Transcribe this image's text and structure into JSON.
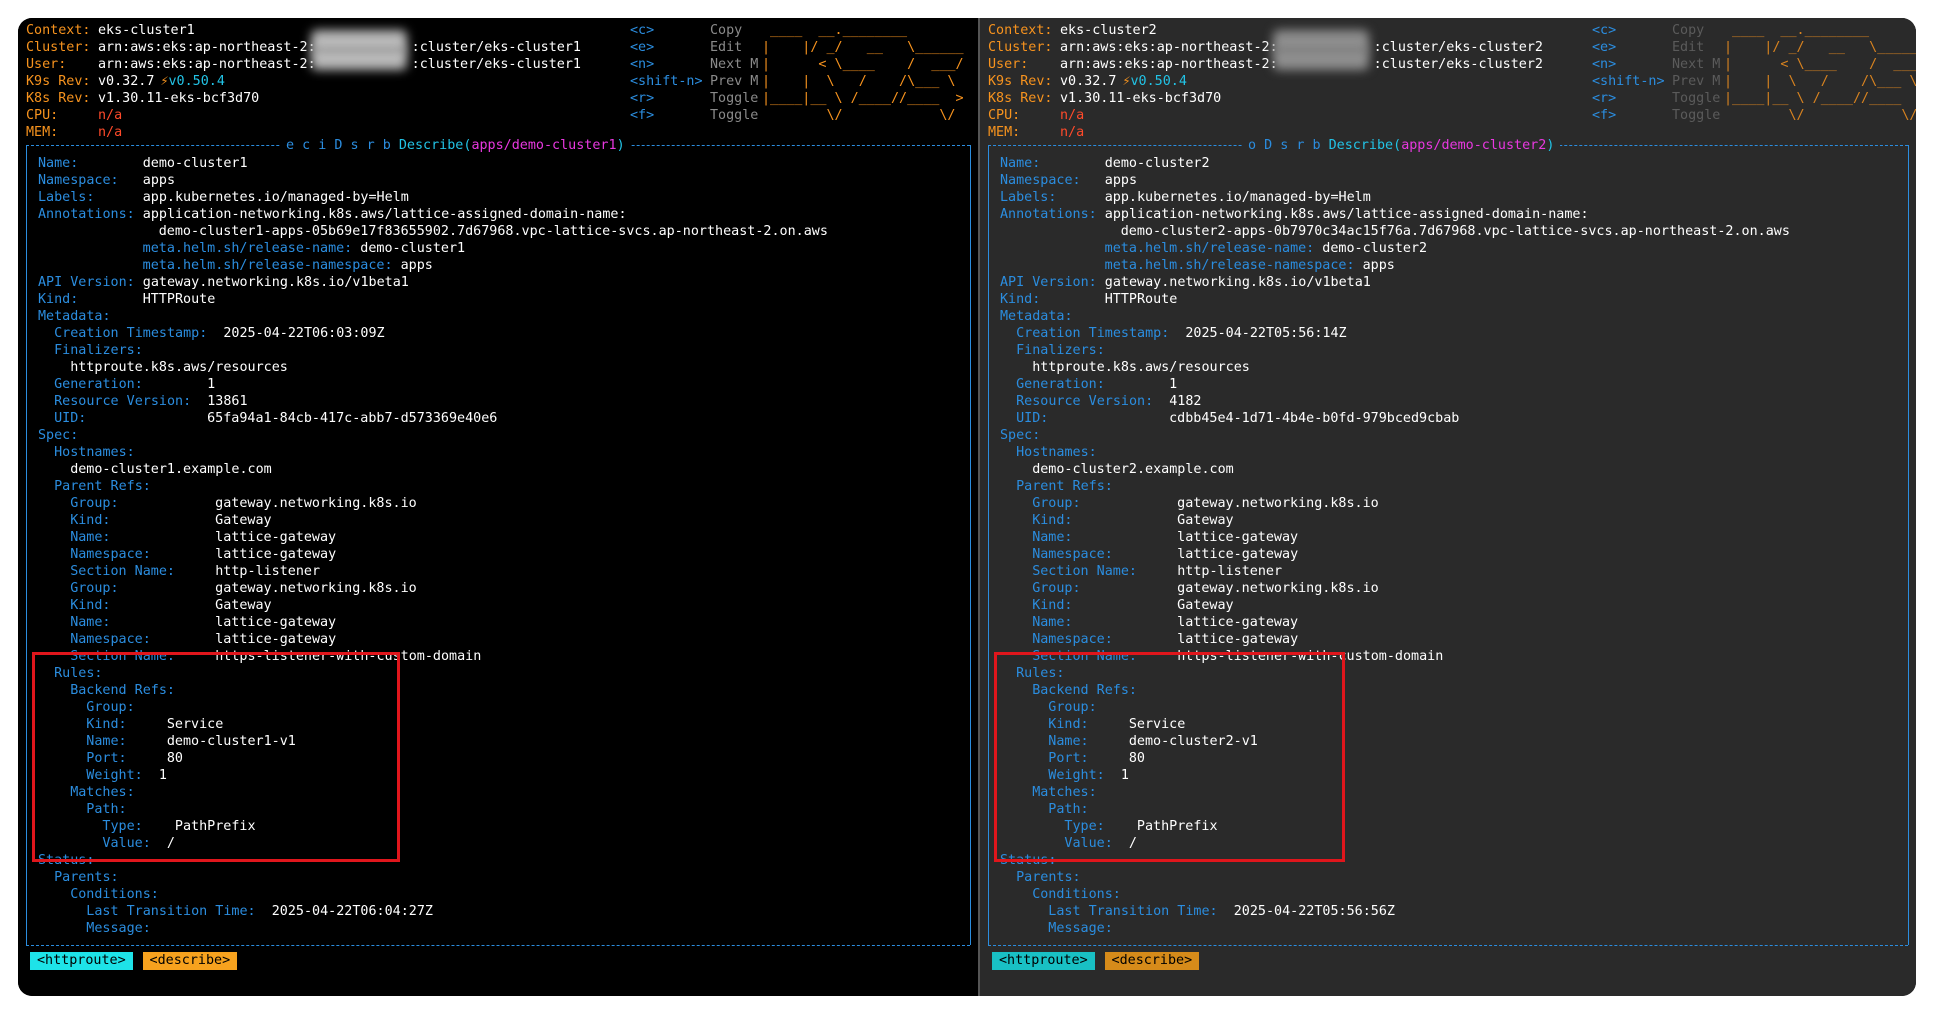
{
  "panes": [
    {
      "id": "cluster1",
      "header": {
        "context_label": "Context:",
        "context": "eks-cluster1",
        "cluster_label": "Cluster:",
        "cluster_prefix": "arn:aws:eks:ap-northeast-2:",
        "cluster_suffix": ":cluster/eks-cluster1",
        "user_label": "User:",
        "user_prefix": "arn:aws:eks:ap-northeast-2:",
        "user_suffix": ":cluster/eks-cluster1",
        "k9s_rev_label": "K9s Rev:",
        "k9s_rev": "v0.32.7",
        "k9s_new": "v0.50.4",
        "bolt": "⚡",
        "k8s_rev_label": "K8s Rev:",
        "k8s_rev": "v1.30.11-eks-bcf3d70",
        "cpu_label": "CPU:",
        "cpu": "n/a",
        "mem_label": "MEM:",
        "mem": "n/a"
      },
      "menu": [
        {
          "key": "<c>",
          "label": "Copy"
        },
        {
          "key": "<e>",
          "label": "Edit"
        },
        {
          "key": "<n>",
          "label": "Next M"
        },
        {
          "key": "<shift-n>",
          "label": "Prev M"
        },
        {
          "key": "<r>",
          "label": "Toggle"
        },
        {
          "key": "<f>",
          "label": "Toggle"
        }
      ],
      "logo_lines": [
        " ____  __.________",
        "|    |/ _/   __   \\______",
        "|      < \\____    /  ___/",
        "|    |  \\   /    /\\___ \\",
        "|____|__ \\ /____//____  >",
        "        \\/            \\/"
      ],
      "title": {
        "hotkeys": "e c i D s r b",
        "word": "Describe",
        "open": "(",
        "resource": "apps/demo-cluster1",
        "close": ")"
      },
      "describe": [
        {
          "i": 0,
          "k": "Name:",
          "v": "demo-cluster1",
          "vx": 13
        },
        {
          "i": 0,
          "k": "Namespace:",
          "v": "apps",
          "vx": 13
        },
        {
          "i": 0,
          "k": "Labels:",
          "v": "app.kubernetes.io/managed-by=Helm",
          "vx": 13
        },
        {
          "i": 0,
          "k": "Annotations:",
          "v": "application-networking.k8s.aws/lattice-assigned-domain-name:",
          "vx": 13
        },
        {
          "i": 15,
          "k": "",
          "v": "demo-cluster1-apps-05b69e17f83655902.7d67968.vpc-lattice-svcs.ap-northeast-2.on.aws",
          "vx": 0
        },
        {
          "i": 13,
          "k": "meta.helm.sh/release-name:",
          "v": "demo-cluster1",
          "vx": 1
        },
        {
          "i": 13,
          "k": "meta.helm.sh/release-namespace:",
          "v": "apps",
          "vx": 1
        },
        {
          "i": 0,
          "k": "API Version:",
          "v": "gateway.networking.k8s.io/v1beta1",
          "vx": 13
        },
        {
          "i": 0,
          "k": "Kind:",
          "v": "HTTPRoute",
          "vx": 13
        },
        {
          "i": 0,
          "k": "Metadata:",
          "v": "",
          "vx": 0
        },
        {
          "i": 2,
          "k": "Creation Timestamp:",
          "v": "2025-04-22T06:03:09Z",
          "vx": 21
        },
        {
          "i": 2,
          "k": "Finalizers:",
          "v": "",
          "vx": 0
        },
        {
          "i": 4,
          "k": "",
          "v": "httproute.k8s.aws/resources",
          "vx": 0
        },
        {
          "i": 2,
          "k": "Generation:",
          "v": "1",
          "vx": 19
        },
        {
          "i": 2,
          "k": "Resource Version:",
          "v": "13861",
          "vx": 19
        },
        {
          "i": 2,
          "k": "UID:",
          "v": "65fa94a1-84cb-417c-abb7-d573369e40e6",
          "vx": 19
        },
        {
          "i": 0,
          "k": "Spec:",
          "v": "",
          "vx": 0
        },
        {
          "i": 2,
          "k": "Hostnames:",
          "v": "",
          "vx": 0
        },
        {
          "i": 4,
          "k": "",
          "v": "demo-cluster1.example.com",
          "vx": 0
        },
        {
          "i": 2,
          "k": "Parent Refs:",
          "v": "",
          "vx": 0
        },
        {
          "i": 4,
          "k": "Group:",
          "v": "gateway.networking.k8s.io",
          "vx": 18
        },
        {
          "i": 4,
          "k": "Kind:",
          "v": "Gateway",
          "vx": 18
        },
        {
          "i": 4,
          "k": "Name:",
          "v": "lattice-gateway",
          "vx": 18
        },
        {
          "i": 4,
          "k": "Namespace:",
          "v": "lattice-gateway",
          "vx": 18
        },
        {
          "i": 4,
          "k": "Section Name:",
          "v": "http-listener",
          "vx": 18
        },
        {
          "i": 4,
          "k": "Group:",
          "v": "gateway.networking.k8s.io",
          "vx": 18
        },
        {
          "i": 4,
          "k": "Kind:",
          "v": "Gateway",
          "vx": 18
        },
        {
          "i": 4,
          "k": "Name:",
          "v": "lattice-gateway",
          "vx": 18
        },
        {
          "i": 4,
          "k": "Namespace:",
          "v": "lattice-gateway",
          "vx": 18
        },
        {
          "i": 4,
          "k": "Section Name:",
          "v": "https-listener-with-custom-domain",
          "vx": 18
        },
        {
          "i": 2,
          "k": "Rules:",
          "v": "",
          "vx": 0
        },
        {
          "i": 4,
          "k": "Backend Refs:",
          "v": "",
          "vx": 0
        },
        {
          "i": 6,
          "k": "Group:",
          "v": "",
          "vx": 0
        },
        {
          "i": 6,
          "k": "Kind:",
          "v": "Service",
          "vx": 10
        },
        {
          "i": 6,
          "k": "Name:",
          "v": "demo-cluster1-v1",
          "vx": 10
        },
        {
          "i": 6,
          "k": "Port:",
          "v": "80",
          "vx": 10
        },
        {
          "i": 6,
          "k": "Weight:",
          "v": "1",
          "vx": 9
        },
        {
          "i": 4,
          "k": "Matches:",
          "v": "",
          "vx": 0
        },
        {
          "i": 6,
          "k": "Path:",
          "v": "",
          "vx": 0
        },
        {
          "i": 8,
          "k": "Type:",
          "v": "PathPrefix",
          "vx": 9
        },
        {
          "i": 8,
          "k": "Value:",
          "v": "/",
          "vx": 8
        },
        {
          "i": 0,
          "k": "Status:",
          "v": "",
          "vx": 0
        },
        {
          "i": 2,
          "k": "Parents:",
          "v": "",
          "vx": 0
        },
        {
          "i": 4,
          "k": "Conditions:",
          "v": "",
          "vx": 0
        },
        {
          "i": 6,
          "k": "Last Transition Time:",
          "v": "2025-04-22T06:04:27Z",
          "vx": 23
        },
        {
          "i": 6,
          "k": "Message:",
          "v": "",
          "vx": 0
        }
      ],
      "crumbs": [
        "<httproute>",
        "<describe>"
      ]
    },
    {
      "id": "cluster2",
      "header": {
        "context_label": "Context:",
        "context": "eks-cluster2",
        "cluster_label": "Cluster:",
        "cluster_prefix": "arn:aws:eks:ap-northeast-2:",
        "cluster_suffix": ":cluster/eks-cluster2",
        "user_label": "User:",
        "user_prefix": "arn:aws:eks:ap-northeast-2:",
        "user_suffix": ":cluster/eks-cluster2",
        "k9s_rev_label": "K9s Rev:",
        "k9s_rev": "v0.32.7",
        "k9s_new": "v0.50.4",
        "bolt": "⚡",
        "k8s_rev_label": "K8s Rev:",
        "k8s_rev": "v1.30.11-eks-bcf3d70",
        "cpu_label": "CPU:",
        "cpu": "n/a",
        "mem_label": "MEM:",
        "mem": "n/a"
      },
      "menu": [
        {
          "key": "<c>",
          "label": "Copy"
        },
        {
          "key": "<e>",
          "label": "Edit"
        },
        {
          "key": "<n>",
          "label": "Next M"
        },
        {
          "key": "<shift-n>",
          "label": "Prev M"
        },
        {
          "key": "<r>",
          "label": "Toggle"
        },
        {
          "key": "<f>",
          "label": "Toggle"
        }
      ],
      "logo_lines": [
        " ____  __.________",
        "|    |/ _/   __   \\______",
        "|      < \\____    /  ___/",
        "|    |  \\   /    /\\___ \\",
        "|____|__ \\ /____//____  >",
        "        \\/            \\/"
      ],
      "title": {
        "hotkeys": "o D s r b",
        "word": "Describe",
        "open": "(",
        "resource": "apps/demo-cluster2",
        "close": ")"
      },
      "describe": [
        {
          "i": 0,
          "k": "Name:",
          "v": "demo-cluster2",
          "vx": 13
        },
        {
          "i": 0,
          "k": "Namespace:",
          "v": "apps",
          "vx": 13
        },
        {
          "i": 0,
          "k": "Labels:",
          "v": "app.kubernetes.io/managed-by=Helm",
          "vx": 13
        },
        {
          "i": 0,
          "k": "Annotations:",
          "v": "application-networking.k8s.aws/lattice-assigned-domain-name:",
          "vx": 13
        },
        {
          "i": 15,
          "k": "",
          "v": "demo-cluster2-apps-0b7970c34ac15f76a.7d67968.vpc-lattice-svcs.ap-northeast-2.on.aws",
          "vx": 0
        },
        {
          "i": 13,
          "k": "meta.helm.sh/release-name:",
          "v": "demo-cluster2",
          "vx": 1
        },
        {
          "i": 13,
          "k": "meta.helm.sh/release-namespace:",
          "v": "apps",
          "vx": 1
        },
        {
          "i": 0,
          "k": "API Version:",
          "v": "gateway.networking.k8s.io/v1beta1",
          "vx": 13
        },
        {
          "i": 0,
          "k": "Kind:",
          "v": "HTTPRoute",
          "vx": 13
        },
        {
          "i": 0,
          "k": "Metadata:",
          "v": "",
          "vx": 0
        },
        {
          "i": 2,
          "k": "Creation Timestamp:",
          "v": "2025-04-22T05:56:14Z",
          "vx": 21
        },
        {
          "i": 2,
          "k": "Finalizers:",
          "v": "",
          "vx": 0
        },
        {
          "i": 4,
          "k": "",
          "v": "httproute.k8s.aws/resources",
          "vx": 0
        },
        {
          "i": 2,
          "k": "Generation:",
          "v": "1",
          "vx": 19
        },
        {
          "i": 2,
          "k": "Resource Version:",
          "v": "4182",
          "vx": 19
        },
        {
          "i": 2,
          "k": "UID:",
          "v": "cdbb45e4-1d71-4b4e-b0fd-979bced9cbab",
          "vx": 19
        },
        {
          "i": 0,
          "k": "Spec:",
          "v": "",
          "vx": 0
        },
        {
          "i": 2,
          "k": "Hostnames:",
          "v": "",
          "vx": 0
        },
        {
          "i": 4,
          "k": "",
          "v": "demo-cluster2.example.com",
          "vx": 0
        },
        {
          "i": 2,
          "k": "Parent Refs:",
          "v": "",
          "vx": 0
        },
        {
          "i": 4,
          "k": "Group:",
          "v": "gateway.networking.k8s.io",
          "vx": 18
        },
        {
          "i": 4,
          "k": "Kind:",
          "v": "Gateway",
          "vx": 18
        },
        {
          "i": 4,
          "k": "Name:",
          "v": "lattice-gateway",
          "vx": 18
        },
        {
          "i": 4,
          "k": "Namespace:",
          "v": "lattice-gateway",
          "vx": 18
        },
        {
          "i": 4,
          "k": "Section Name:",
          "v": "http-listener",
          "vx": 18
        },
        {
          "i": 4,
          "k": "Group:",
          "v": "gateway.networking.k8s.io",
          "vx": 18
        },
        {
          "i": 4,
          "k": "Kind:",
          "v": "Gateway",
          "vx": 18
        },
        {
          "i": 4,
          "k": "Name:",
          "v": "lattice-gateway",
          "vx": 18
        },
        {
          "i": 4,
          "k": "Namespace:",
          "v": "lattice-gateway",
          "vx": 18
        },
        {
          "i": 4,
          "k": "Section Name:",
          "v": "https-listener-with-custom-domain",
          "vx": 18
        },
        {
          "i": 2,
          "k": "Rules:",
          "v": "",
          "vx": 0
        },
        {
          "i": 4,
          "k": "Backend Refs:",
          "v": "",
          "vx": 0
        },
        {
          "i": 6,
          "k": "Group:",
          "v": "",
          "vx": 0
        },
        {
          "i": 6,
          "k": "Kind:",
          "v": "Service",
          "vx": 10
        },
        {
          "i": 6,
          "k": "Name:",
          "v": "demo-cluster2-v1",
          "vx": 10
        },
        {
          "i": 6,
          "k": "Port:",
          "v": "80",
          "vx": 10
        },
        {
          "i": 6,
          "k": "Weight:",
          "v": "1",
          "vx": 9
        },
        {
          "i": 4,
          "k": "Matches:",
          "v": "",
          "vx": 0
        },
        {
          "i": 6,
          "k": "Path:",
          "v": "",
          "vx": 0
        },
        {
          "i": 8,
          "k": "Type:",
          "v": "PathPrefix",
          "vx": 9
        },
        {
          "i": 8,
          "k": "Value:",
          "v": "/",
          "vx": 8
        },
        {
          "i": 0,
          "k": "Status:",
          "v": "",
          "vx": 0
        },
        {
          "i": 2,
          "k": "Parents:",
          "v": "",
          "vx": 0
        },
        {
          "i": 4,
          "k": "Conditions:",
          "v": "",
          "vx": 0
        },
        {
          "i": 6,
          "k": "Last Transition Time:",
          "v": "2025-04-22T05:56:56Z",
          "vx": 23
        },
        {
          "i": 6,
          "k": "Message:",
          "v": "",
          "vx": 0
        }
      ],
      "crumbs": [
        "<httproute>",
        "<describe>"
      ]
    }
  ]
}
